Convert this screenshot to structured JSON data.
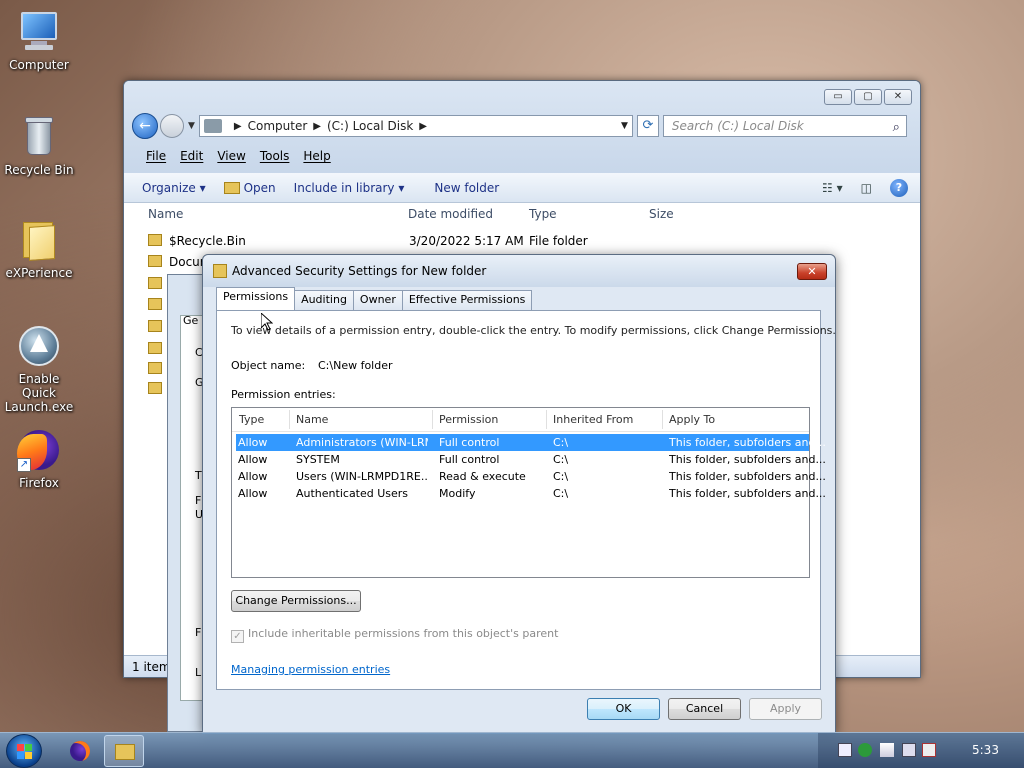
{
  "desktop": {
    "icons": [
      {
        "label": "Computer"
      },
      {
        "label": "Recycle Bin"
      },
      {
        "label": "eXPerience"
      },
      {
        "label": "Enable Quick Launch.exe"
      },
      {
        "label": "Firefox"
      }
    ]
  },
  "explorer": {
    "window_buttons": {
      "minimize": "▭",
      "maximize": "▢",
      "close": "✕"
    },
    "address": {
      "parts": [
        "Computer",
        "(C:) Local Disk"
      ]
    },
    "search_placeholder": "Search (C:) Local Disk",
    "menu": [
      "File",
      "Edit",
      "View",
      "Tools",
      "Help"
    ],
    "commands": {
      "organize": "Organize ▾",
      "open": "Open",
      "include": "Include in library ▾",
      "new_folder": "New folder"
    },
    "columns": {
      "name": "Name",
      "date": "Date modified",
      "type": "Type",
      "size": "Size"
    },
    "files": [
      {
        "name": "$Recycle.Bin",
        "date": "3/20/2022 5:17 AM",
        "type": "File folder"
      },
      {
        "name": "Docum"
      }
    ],
    "status": "1 item"
  },
  "properties_dialog": {
    "tab_fragment": "Ge",
    "letters": [
      "C",
      "G",
      "T",
      "F",
      "U",
      "F",
      "L"
    ]
  },
  "advanced": {
    "title": "Advanced Security Settings for New folder",
    "close": "✕",
    "tabs": [
      "Permissions",
      "Auditing",
      "Owner",
      "Effective Permissions"
    ],
    "intro": "To view details of a permission entry, double-click the entry. To modify permissions, click Change Permissions.",
    "object_label": "Object name:",
    "object_value": "C:\\New folder",
    "entries_label": "Permission entries:",
    "grid_headers": [
      "Type",
      "Name",
      "Permission",
      "Inherited From",
      "Apply To"
    ],
    "entries": [
      {
        "type": "Allow",
        "name": "Administrators (WIN-LRM...",
        "permission": "Full control",
        "inherited": "C:\\",
        "apply": "This folder, subfolders and..."
      },
      {
        "type": "Allow",
        "name": "SYSTEM",
        "permission": "Full control",
        "inherited": "C:\\",
        "apply": "This folder, subfolders and..."
      },
      {
        "type": "Allow",
        "name": "Users (WIN-LRMPD1RE...",
        "permission": "Read & execute",
        "inherited": "C:\\",
        "apply": "This folder, subfolders and..."
      },
      {
        "type": "Allow",
        "name": "Authenticated Users",
        "permission": "Modify",
        "inherited": "C:\\",
        "apply": "This folder, subfolders and..."
      }
    ],
    "change_btn": "Change Permissions...",
    "checkbox_mark": "✓",
    "checkbox_label": "Include inheritable permissions from this object's parent",
    "link": "Managing permission entries",
    "ok": "OK",
    "cancel": "Cancel",
    "apply": "Apply"
  },
  "taskbar": {
    "clock": "5:33"
  }
}
